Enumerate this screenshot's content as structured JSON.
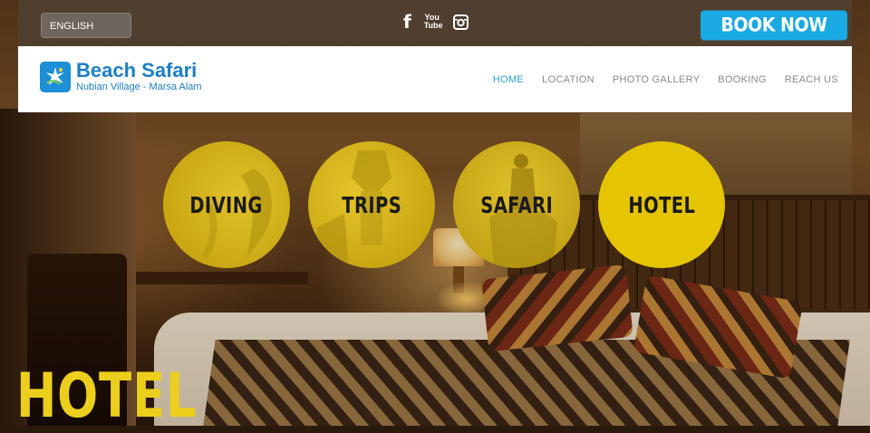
{
  "topbar": {
    "language": "ENGLISH",
    "social": [
      {
        "icon": "facebook-icon",
        "label": "f"
      },
      {
        "icon": "youtube-icon",
        "label": "You Tube"
      },
      {
        "icon": "instagram-icon"
      }
    ],
    "book_label": "BOOK NOW"
  },
  "header": {
    "logo_title": "Beach Safari",
    "logo_subtitle": "Nubian Village - Marsa Alam",
    "nav": [
      "HOME",
      "LOCATION",
      "PHOTO GALLERY",
      "BOOKING",
      "REACH US"
    ],
    "active_nav": "HOME"
  },
  "circles": [
    "DIVING",
    "TRIPS",
    "SAFARI",
    "HOTEL"
  ],
  "page_heading": "HOTEL",
  "colors": {
    "accent_yellow": "#e5c400",
    "book_blue": "#19a9e3",
    "nav_active": "#27a4dc",
    "logo_blue": "#1b7fc4"
  }
}
